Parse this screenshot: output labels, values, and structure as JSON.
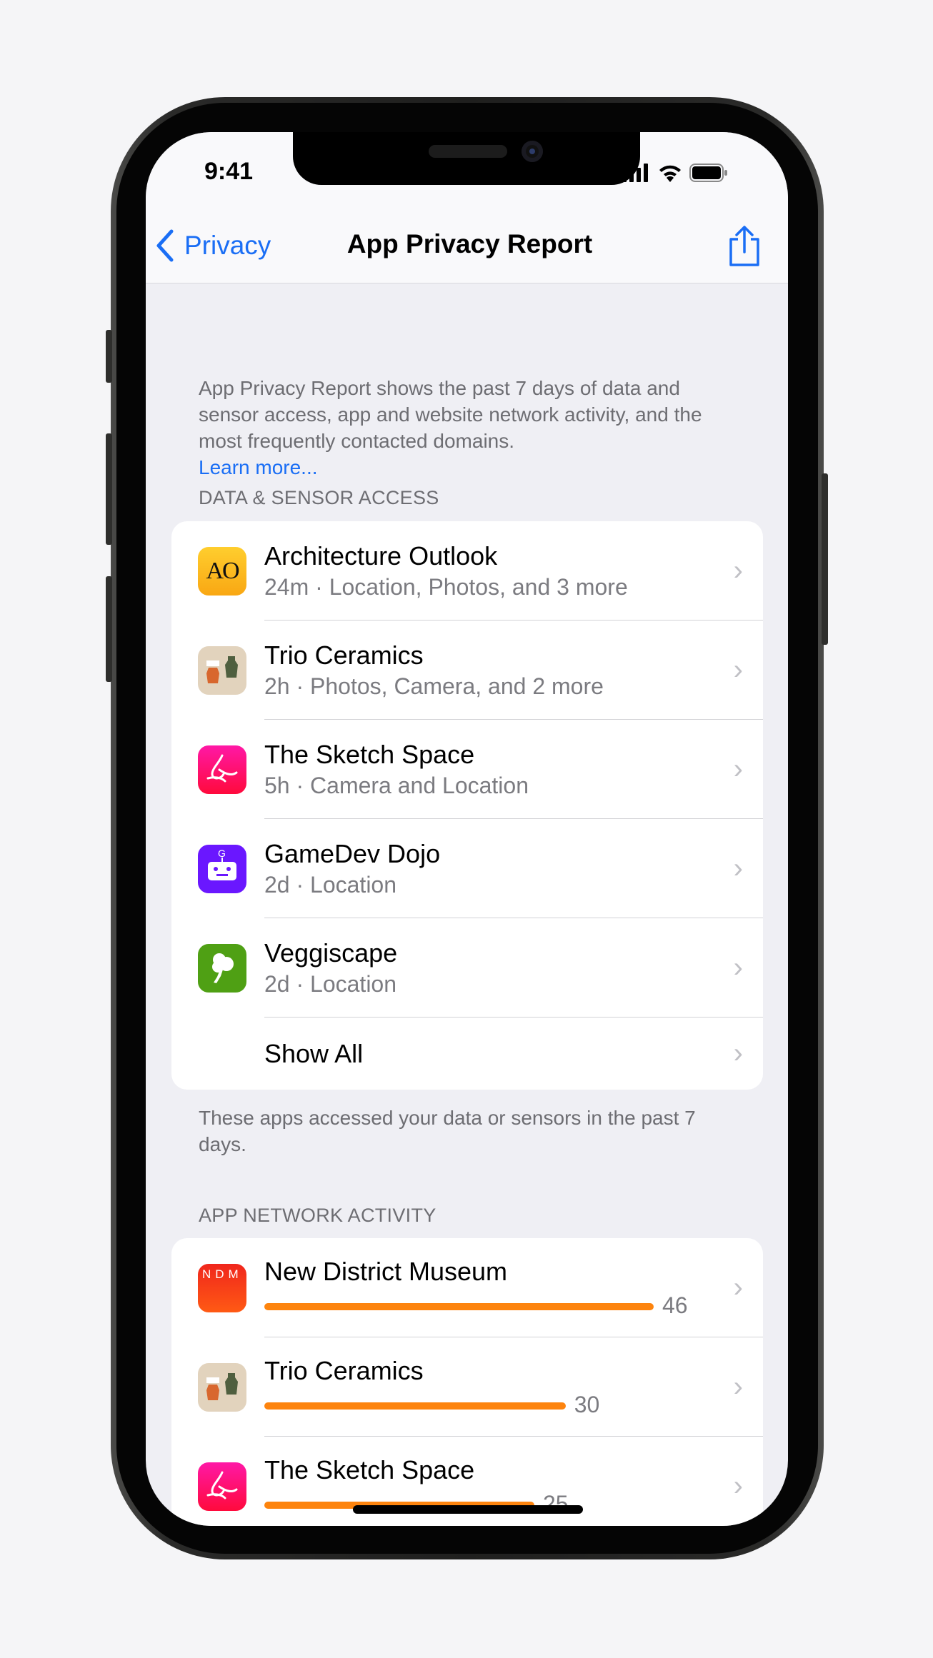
{
  "status_bar": {
    "time": "9:41"
  },
  "nav": {
    "back_label": "Privacy",
    "title": "App Privacy Report"
  },
  "intro": {
    "text": "App Privacy Report shows the past 7 days of data and sensor access, app and website network activity, and the most frequently contacted domains.",
    "link": "Learn more..."
  },
  "data_access": {
    "header": "DATA & SENSOR ACCESS",
    "items": [
      {
        "name": "Architecture Outlook",
        "detail": "24m · Location, Photos, and 3 more",
        "icon": "architecture-outlook-icon",
        "logo": "AO"
      },
      {
        "name": "Trio Ceramics",
        "detail": "2h · Photos, Camera, and 2 more",
        "icon": "trio-ceramics-icon"
      },
      {
        "name": "The Sketch Space",
        "detail": "5h · Camera and Location",
        "icon": "sketch-space-icon"
      },
      {
        "name": "GameDev Dojo",
        "detail": "2d · Location",
        "icon": "gamedev-dojo-icon",
        "logo": "G"
      },
      {
        "name": "Veggiscape",
        "detail": "2d · Location",
        "icon": "veggiscape-icon"
      }
    ],
    "show_all": "Show All",
    "footer": "These apps accessed your data or sensors in the past 7 days."
  },
  "network": {
    "header": "APP NETWORK ACTIVITY",
    "bar_color": "#fd840e",
    "items": [
      {
        "name": "New District Museum",
        "count": 46,
        "icon": "new-district-museum-icon",
        "logo": "NDM"
      },
      {
        "name": "Trio Ceramics",
        "count": 30,
        "icon": "trio-ceramics-icon"
      },
      {
        "name": "The Sketch Space",
        "count": 25,
        "icon": "sketch-space-icon"
      }
    ]
  },
  "colors": {
    "accent": "#1a6ef5",
    "background": "#efeff4"
  }
}
